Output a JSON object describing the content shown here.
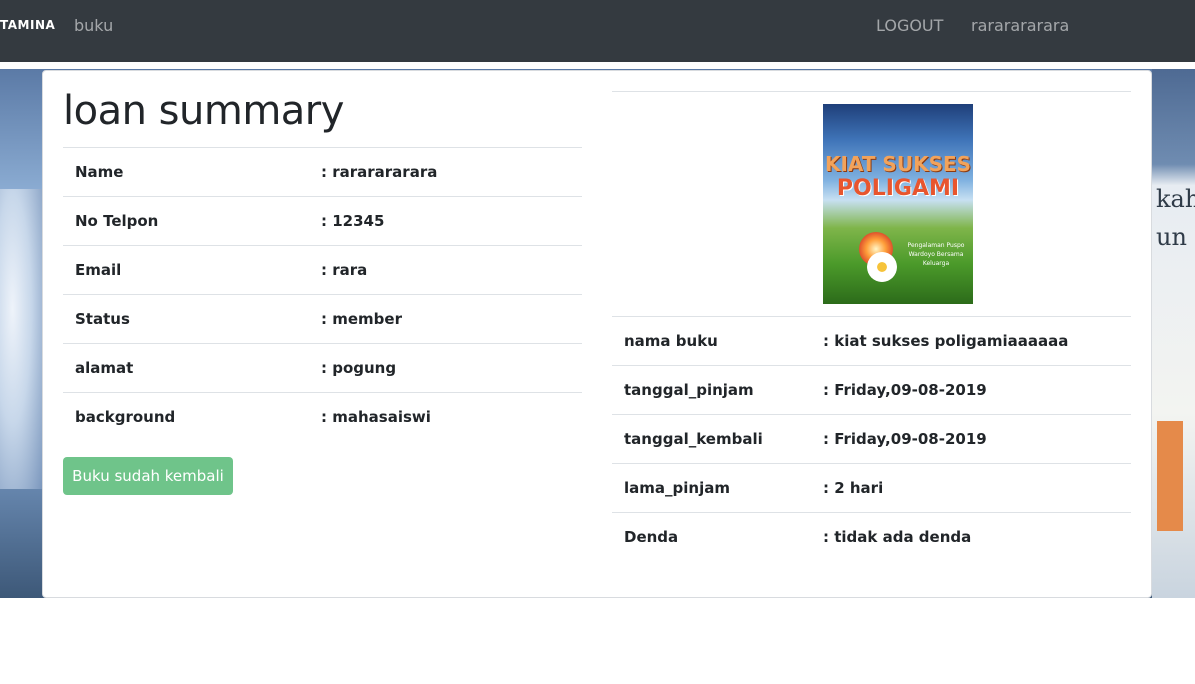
{
  "navbar": {
    "brand": "TAMINA",
    "links": {
      "buku": "buku",
      "logout": "LOGOUT",
      "user": "rararararara"
    }
  },
  "page": {
    "title": "loan summary"
  },
  "member": {
    "rows": [
      {
        "label": "Name",
        "value": ": rararararara"
      },
      {
        "label": "No Telpon",
        "value": ": 12345"
      },
      {
        "label": "Email",
        "value": ": rara"
      },
      {
        "label": "Status",
        "value": ": member"
      },
      {
        "label": "alamat",
        "value": ": pogung"
      },
      {
        "label": "background",
        "value": ": mahasaiswi"
      }
    ],
    "button_label": "Buku sudah kembali"
  },
  "book": {
    "cover": {
      "title_line1": "KIAT SUKSES",
      "title_line2": "POLIGAMI",
      "subtitle": "Pengalaman Puspo Wardoyo Bersama Keluarga"
    },
    "rows": [
      {
        "label": "nama buku",
        "value": ": kiat sukses poligamiaaaaaa"
      },
      {
        "label": "tanggal_pinjam",
        "value": ": Friday,09-08-2019"
      },
      {
        "label": "tanggal_kembali",
        "value": ": Friday,09-08-2019"
      },
      {
        "label": "lama_pinjam",
        "value": ": 2 hari"
      },
      {
        "label": "Denda",
        "value": ": tidak ada denda"
      }
    ]
  },
  "background": {
    "text_line1": "kah",
    "text_line2": "un"
  },
  "colors": {
    "navbar": "#343a40",
    "button": "#6fc48a"
  }
}
